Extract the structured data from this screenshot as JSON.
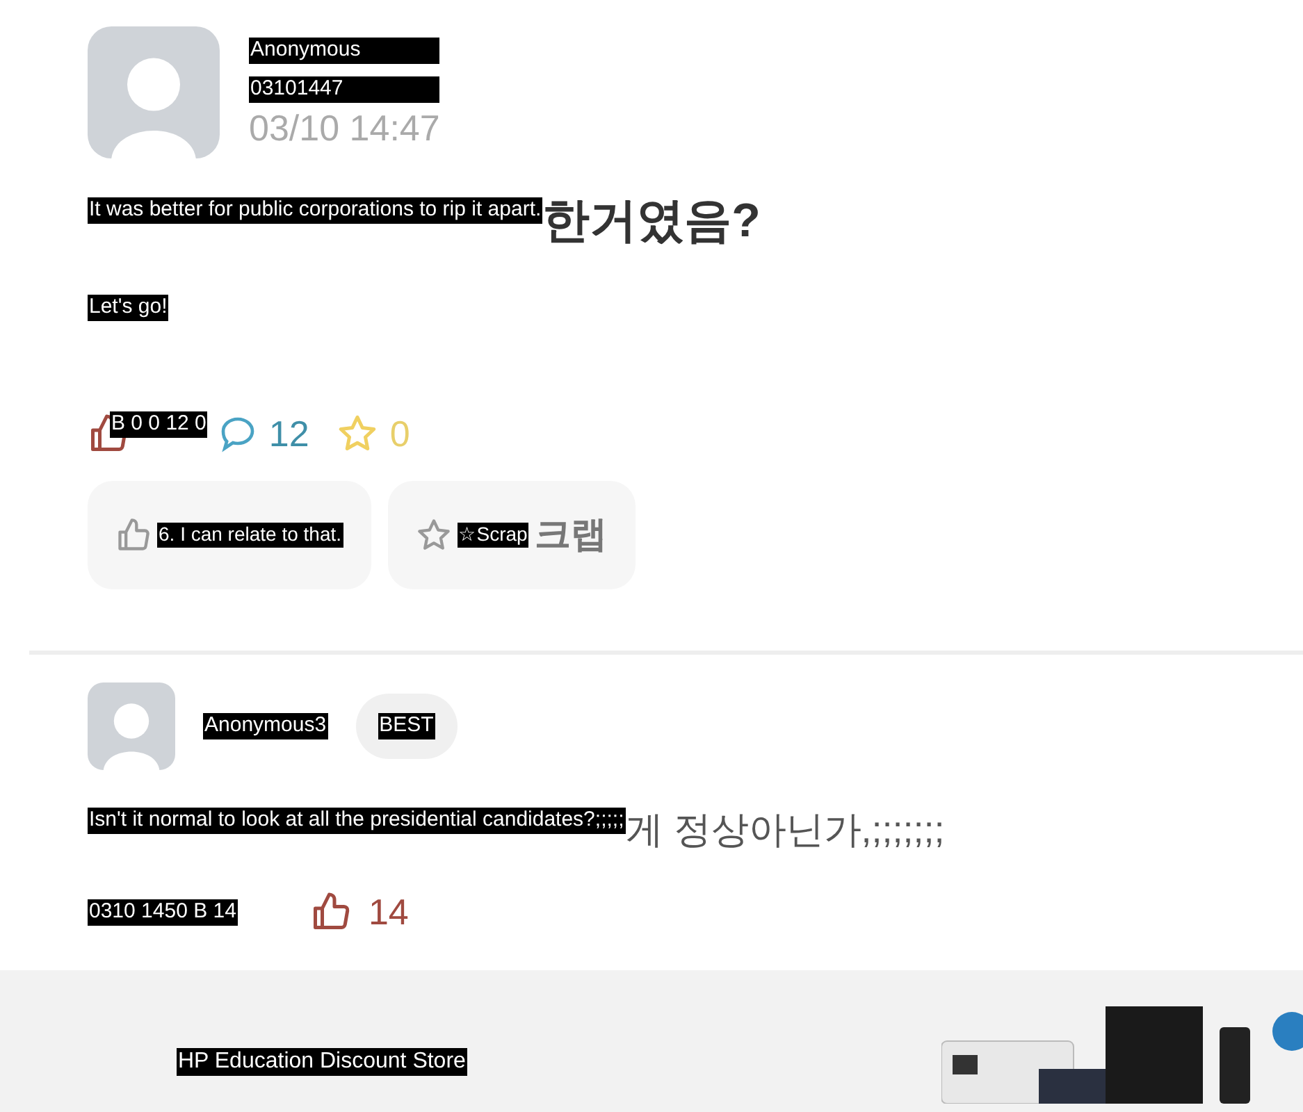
{
  "post": {
    "author": "Anonymous",
    "author_id": "03101447",
    "time": "03/10 14:47",
    "title": "It was better for public corporations to rip it apart.",
    "title_tail": "한거였음?",
    "body": "Let's go!",
    "stats_label": "B 0 0 12 0",
    "comments": "12",
    "scraps": "0",
    "actions": [
      {
        "kind": "like",
        "label": "6. I can relate to that."
      },
      {
        "kind": "scrap",
        "label": "☆Scrap",
        "tail": "크랩"
      }
    ]
  },
  "comment": {
    "author": "Anonymous3",
    "badge": "BEST",
    "text": "Isn't it normal to look at all the presidential candidates?;;;;;",
    "text_tail": "게 정상아닌가,;;;;;;;",
    "meta": "0310 1450 B 14",
    "likes": "14"
  },
  "ad": {
    "title": "HP Education Discount Store"
  }
}
